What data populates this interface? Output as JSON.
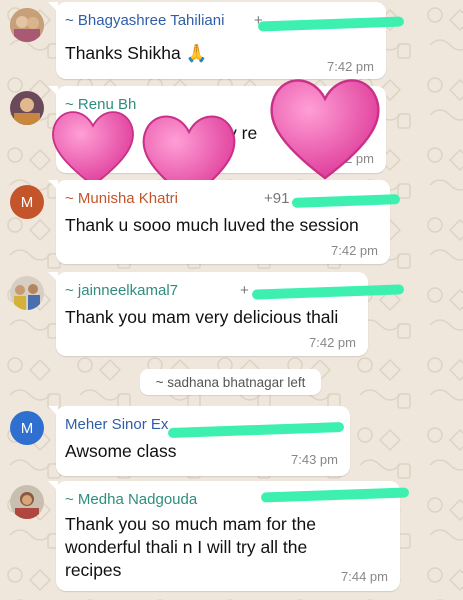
{
  "colors": {
    "background": "#efe7dc",
    "bubble": "#ffffff",
    "redaction": "#3ef0b0",
    "heart": "#ee4aa8"
  },
  "messages": [
    {
      "sender": "~ Bhagyashree Tahiliani",
      "sender_color": "#2f5ea8",
      "phone": "+",
      "text": "Thanks Shikha 🙏",
      "time": "7:42 pm"
    },
    {
      "sender": "~ Renu Bh",
      "sender_color": "#2f8d7f",
      "text_start": "d",
      "text_end": "y re",
      "time": "7:42 pm"
    },
    {
      "sender": "~ Munisha Khatri",
      "sender_color": "#c4552b",
      "phone": "+91",
      "text": "Thank u sooo much luved the session",
      "time": "7:42 pm",
      "avatar_letter": "M"
    },
    {
      "sender": "~ jainneelkamal7",
      "sender_color": "#2f8d7f",
      "phone": "+",
      "text": "Thank you mam very delicious thali",
      "time": "7:42 pm"
    },
    {
      "sender": "Meher Sinor Ex",
      "sender_color": "#2f5ea8",
      "text": "Awsome class",
      "time": "7:43 pm",
      "avatar_letter": "M"
    },
    {
      "sender": "~ Medha Nadgouda",
      "sender_color": "#2f8d7f",
      "text_lines": [
        "Thank you so much mam for the",
        "wonderful thali n I will try all the",
        "recipes"
      ],
      "time": "7:44 pm"
    }
  ],
  "system_message": "~ sadhana bhatnagar left"
}
